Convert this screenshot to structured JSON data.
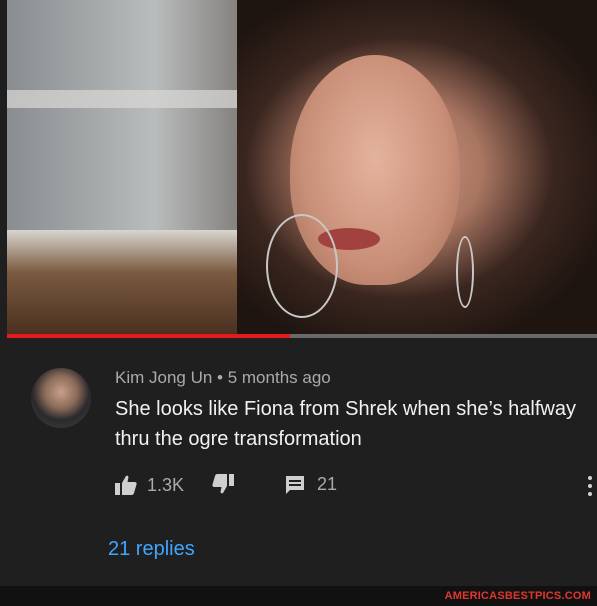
{
  "video": {
    "progress_fraction": 0.48,
    "colors": {
      "progress": "#e31b1b",
      "track": "#6a6a6a"
    }
  },
  "comment": {
    "author": "Kim Jong Un",
    "separator": "•",
    "timestamp": "5 months ago",
    "author_line": "Kim Jong Un • 5 months ago",
    "text": "She looks like Fiona from Shrek when she’s halfway thru the ogre transformation",
    "likes": "1.3K",
    "replies_count": "21",
    "view_replies_label": "21 replies"
  },
  "icons": {
    "like": "thumbs-up-icon",
    "dislike": "thumbs-down-icon",
    "reply": "comment-icon",
    "more": "more-vert-icon"
  },
  "watermark": "AMERICASBESTPICS.COM",
  "colors": {
    "background": "#1f1f1f",
    "link": "#3ea6ff",
    "watermark": "#e0372d"
  }
}
